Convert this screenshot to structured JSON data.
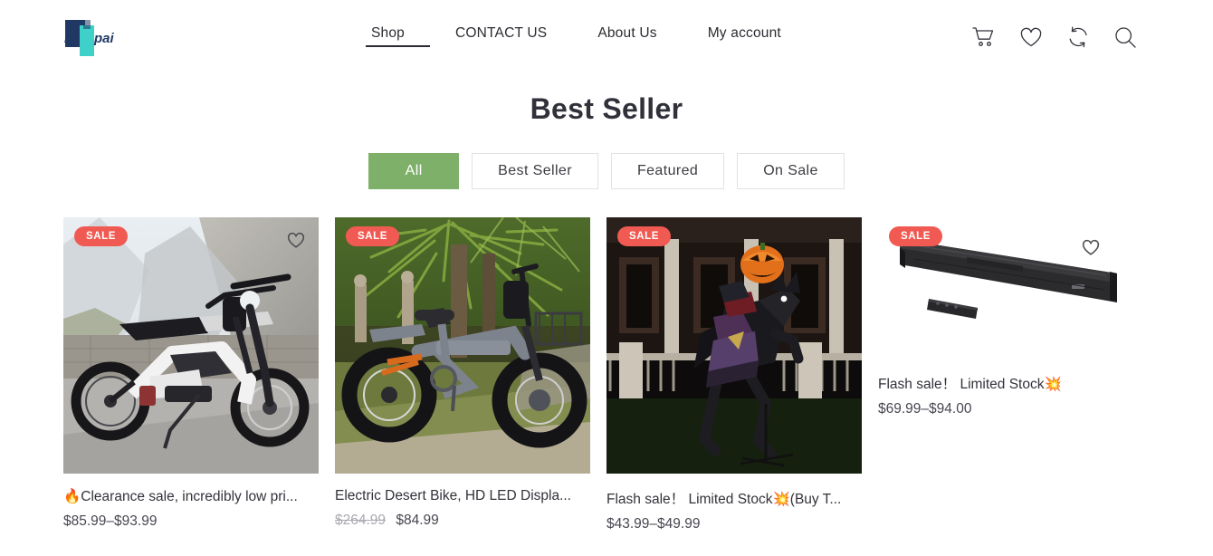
{
  "header": {
    "logo_text": "repai",
    "nav": [
      {
        "label": "Shop",
        "active": true
      },
      {
        "label": "CONTACT US",
        "active": false
      },
      {
        "label": "About Us",
        "active": false
      },
      {
        "label": "My account",
        "active": false
      }
    ],
    "icons": [
      {
        "name": "cart-icon",
        "label": "Cart"
      },
      {
        "name": "wishlist-heart-icon",
        "label": "Wishlist"
      },
      {
        "name": "compare-icon",
        "label": "Compare"
      },
      {
        "name": "search-icon",
        "label": "Search"
      }
    ]
  },
  "main": {
    "title": "Best Seller",
    "filters": [
      {
        "label": "All",
        "active": true
      },
      {
        "label": "Best Seller",
        "active": false
      },
      {
        "label": "Featured",
        "active": false
      },
      {
        "label": "On Sale",
        "active": false
      }
    ],
    "products": [
      {
        "badge": "SALE",
        "title": "🔥Clearance sale, incredibly low pri...",
        "price": "$85.99–$93.99",
        "old_price": "",
        "image_alt": "electric dirt bike on mountain road"
      },
      {
        "badge": "SALE",
        "title": "Electric Desert Bike, HD LED Displa...",
        "price": "$84.99",
        "old_price": "$264.99",
        "image_alt": "gray fat tire folding electric bike in park"
      },
      {
        "badge": "SALE",
        "title": "Flash sale！ Limited Stock💥(Buy T...",
        "price": "$43.99–$49.99",
        "old_price": "",
        "image_alt": "halloween headless horseman animatronic on porch"
      },
      {
        "badge": "SALE",
        "title": "Flash sale！ Limited Stock💥",
        "price": "$69.99–$94.00",
        "old_price": "",
        "image_alt": "black soundbar speaker with remote"
      }
    ]
  },
  "colors": {
    "accent_green": "#7fb069",
    "sale_red": "#f05a52",
    "text_dark": "#31313a",
    "logo_navy": "#1f3864",
    "logo_teal": "#3fd0c9"
  }
}
